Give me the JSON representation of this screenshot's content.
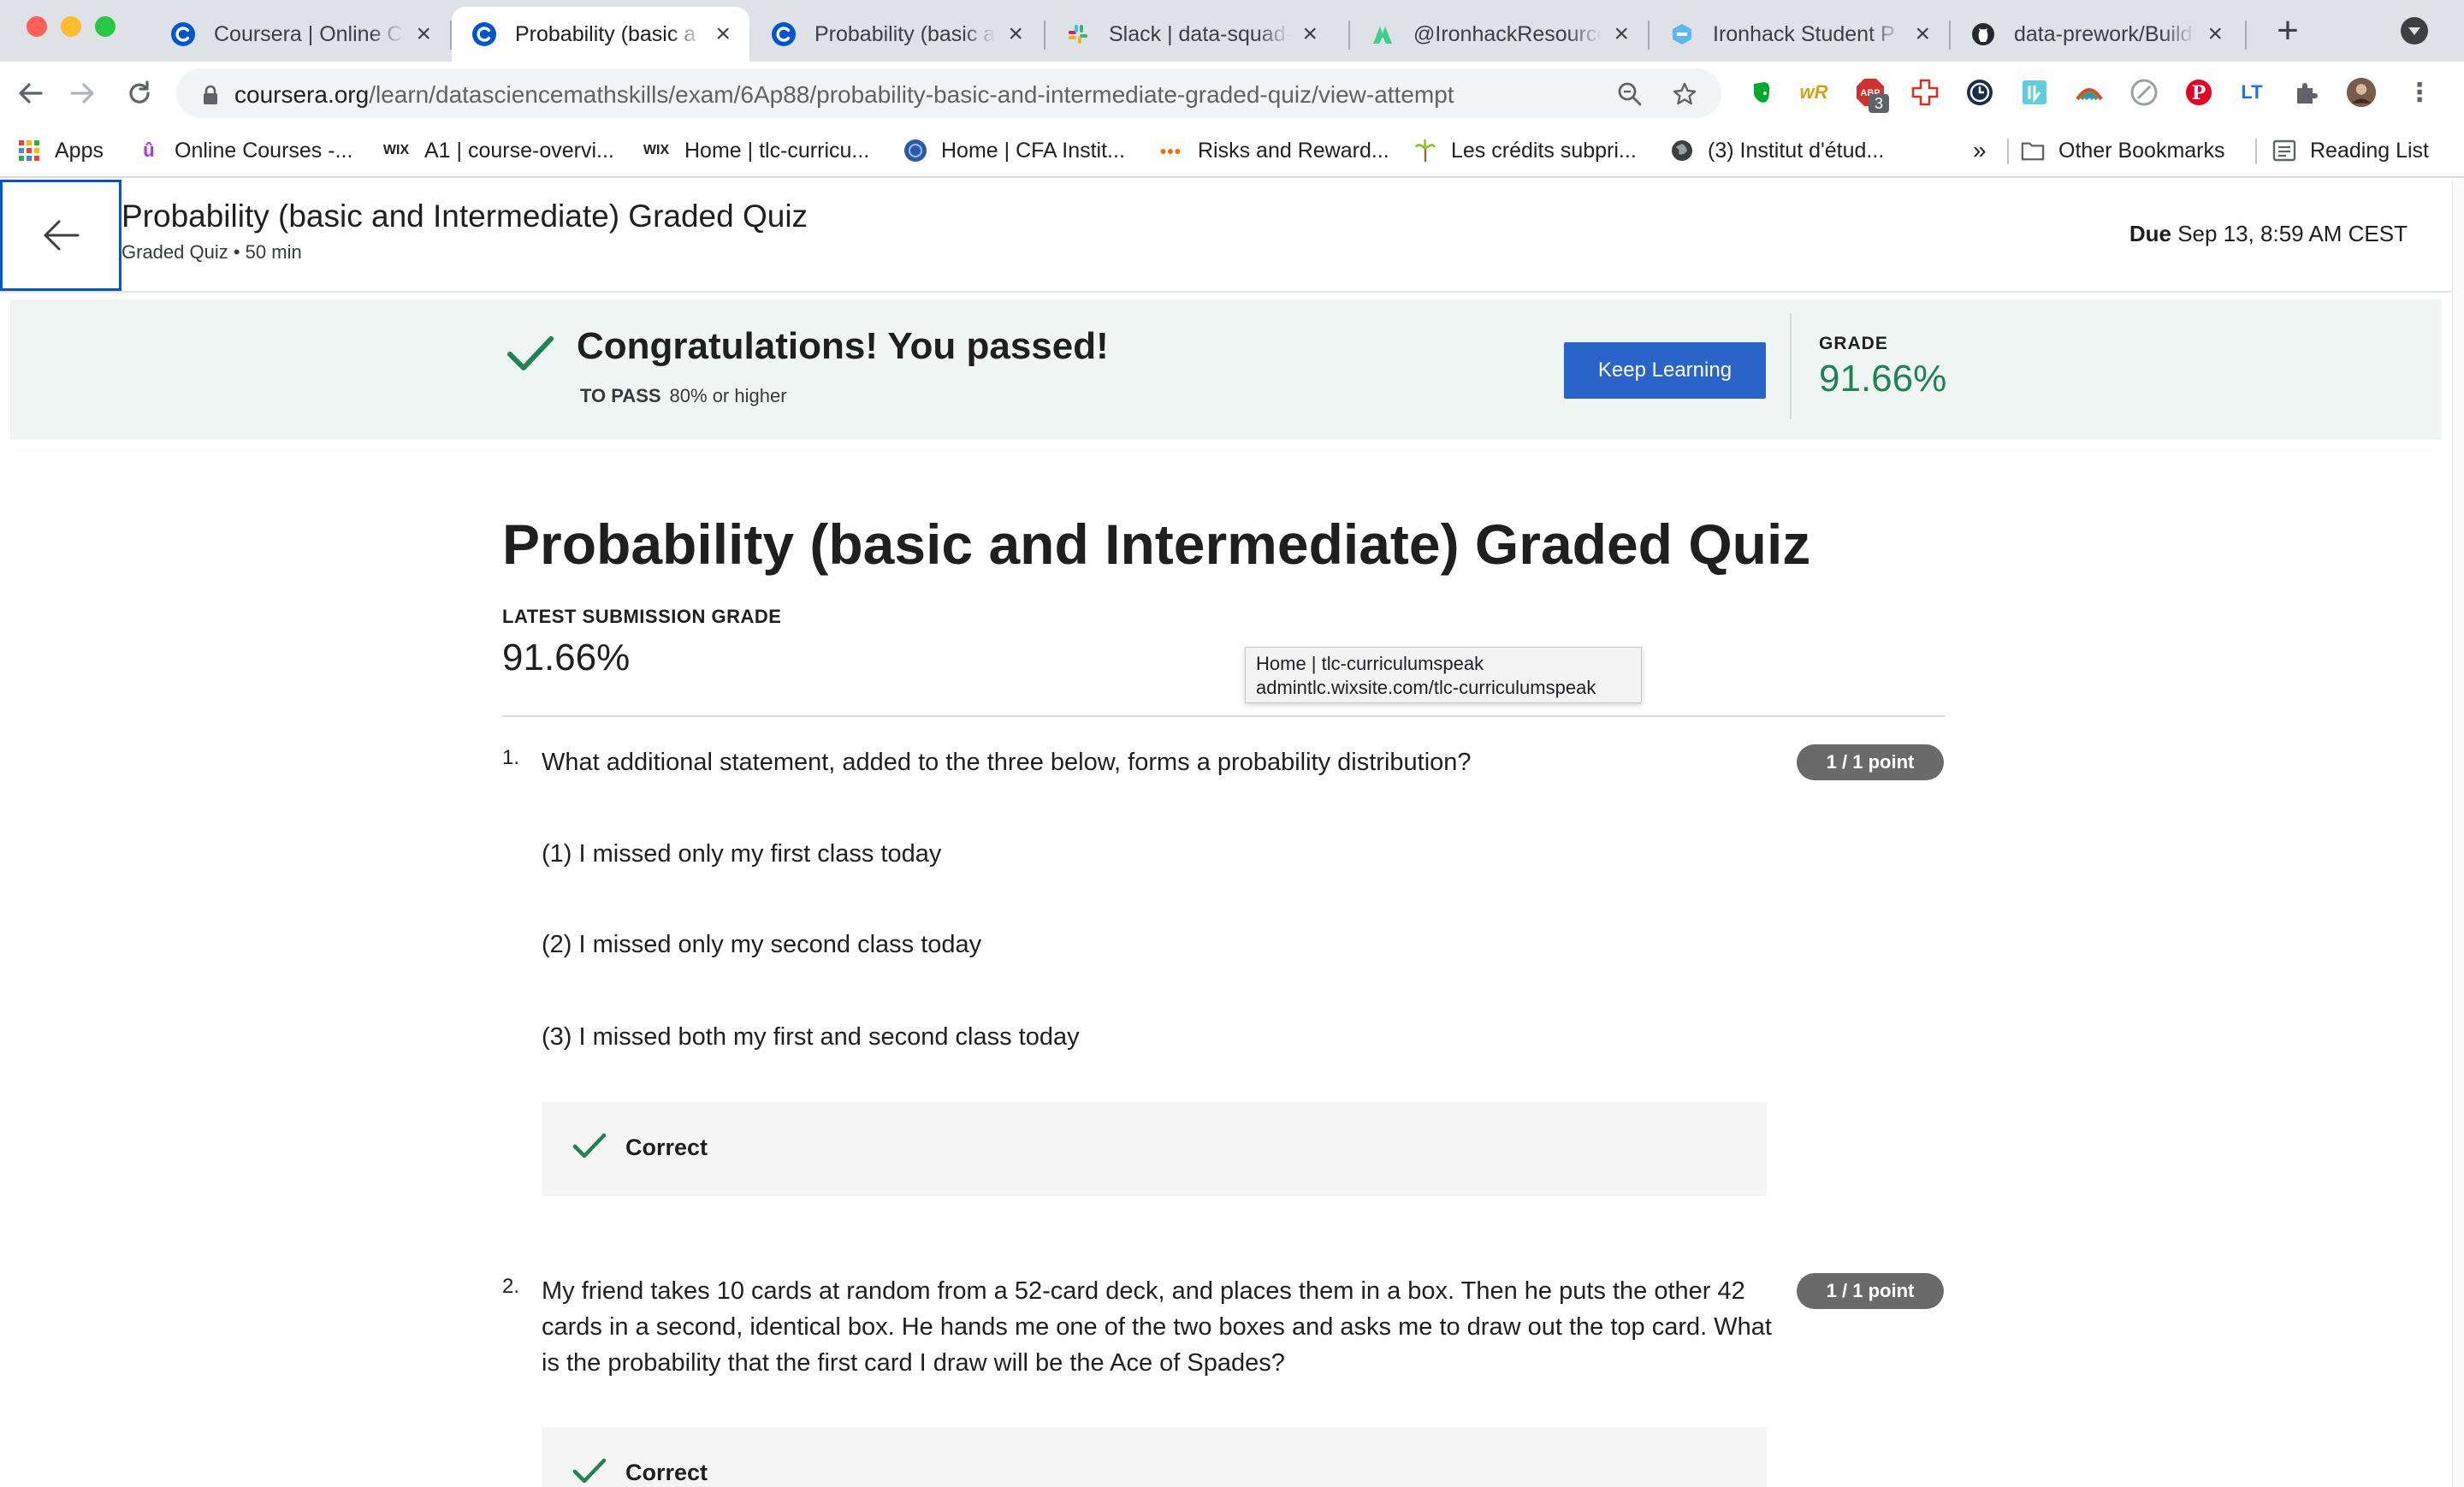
{
  "browser": {
    "tabs": [
      {
        "title": "Coursera | Online C",
        "favicon": "coursera-icon",
        "active": false
      },
      {
        "title": "Probability (basic a",
        "favicon": "coursera-icon",
        "active": true
      },
      {
        "title": "Probability (basic a",
        "favicon": "coursera-icon",
        "active": false
      },
      {
        "title": "Slack | data-squad-",
        "favicon": "slack-icon",
        "active": false
      },
      {
        "title": "@IronhackResource",
        "favicon": "ironhack-resources-icon",
        "active": false
      },
      {
        "title": "Ironhack Student P",
        "favicon": "ironhack-icon",
        "active": false
      },
      {
        "title": "data-prework/Build",
        "favicon": "github-icon",
        "active": false
      }
    ],
    "url": {
      "domain": "coursera.org",
      "path": "/learn/datasciencemathskills/exam/6Ap88/probability-basic-and-intermediate-graded-quiz/view-attempt"
    },
    "extension_badge": "3",
    "bookmarks": [
      {
        "label": "Apps",
        "icon": "apps-grid-icon"
      },
      {
        "label": "Online Courses -...",
        "icon": "udemy-icon"
      },
      {
        "label": "A1 | course-overvi...",
        "icon": "wix-icon"
      },
      {
        "label": "Home | tlc-curricu...",
        "icon": "wix-icon"
      },
      {
        "label": "Home | CFA Instit...",
        "icon": "cfa-icon"
      },
      {
        "label": "Risks and Reward...",
        "icon": "bookmark-site-icon"
      },
      {
        "label": "Les crédits subpri...",
        "icon": "palm-icon"
      },
      {
        "label": "(3) Institut d'étud...",
        "icon": "globe-icon"
      }
    ],
    "overflow_label": "»",
    "other_bookmarks": "Other Bookmarks",
    "reading_list": "Reading List",
    "tooltip": {
      "title": "Home | tlc-curriculumspeak",
      "url": "admintlc.wixsite.com/tlc-curriculumspeak"
    }
  },
  "header": {
    "title": "Probability (basic and Intermediate) Graded Quiz",
    "subtitle": "Graded Quiz • 50 min",
    "due_label": "Due",
    "due_value": "Sep 13, 8:59 AM CEST"
  },
  "banner": {
    "message": "Congratulations! You passed!",
    "to_pass_label": "TO PASS",
    "to_pass_value": "80% or higher",
    "button_label": "Keep Learning",
    "grade_label": "GRADE",
    "grade_value": "91.66%"
  },
  "main": {
    "title": "Probability (basic and Intermediate) Graded Quiz",
    "latest_grade_label": "LATEST SUBMISSION GRADE",
    "latest_grade_value": "91.66%",
    "questions": [
      {
        "number": "1.",
        "text": "What additional statement, added to the three below, forms a probability distribution?",
        "points": "1 / 1 point",
        "statements": [
          "(1) I missed only my first class today",
          "(2) I missed only my second class today",
          "(3) I missed both my first and second class today"
        ],
        "feedback": "Correct"
      },
      {
        "number": "2.",
        "text": "My friend takes 10 cards at random from a 52-card deck, and places them in a box. Then he puts the other 42 cards in a second, identical box. He hands me one of the two boxes and asks me to draw out the top card. What is the probability that the first card I draw will be the Ace of Spades?",
        "points": "1 / 1 point",
        "feedback": "Correct"
      }
    ]
  },
  "colors": {
    "accent_blue": "#2a64c9",
    "focus_blue": "#0056d2",
    "success_green": "#1f8354",
    "banner_bg": "#eef5f2"
  }
}
